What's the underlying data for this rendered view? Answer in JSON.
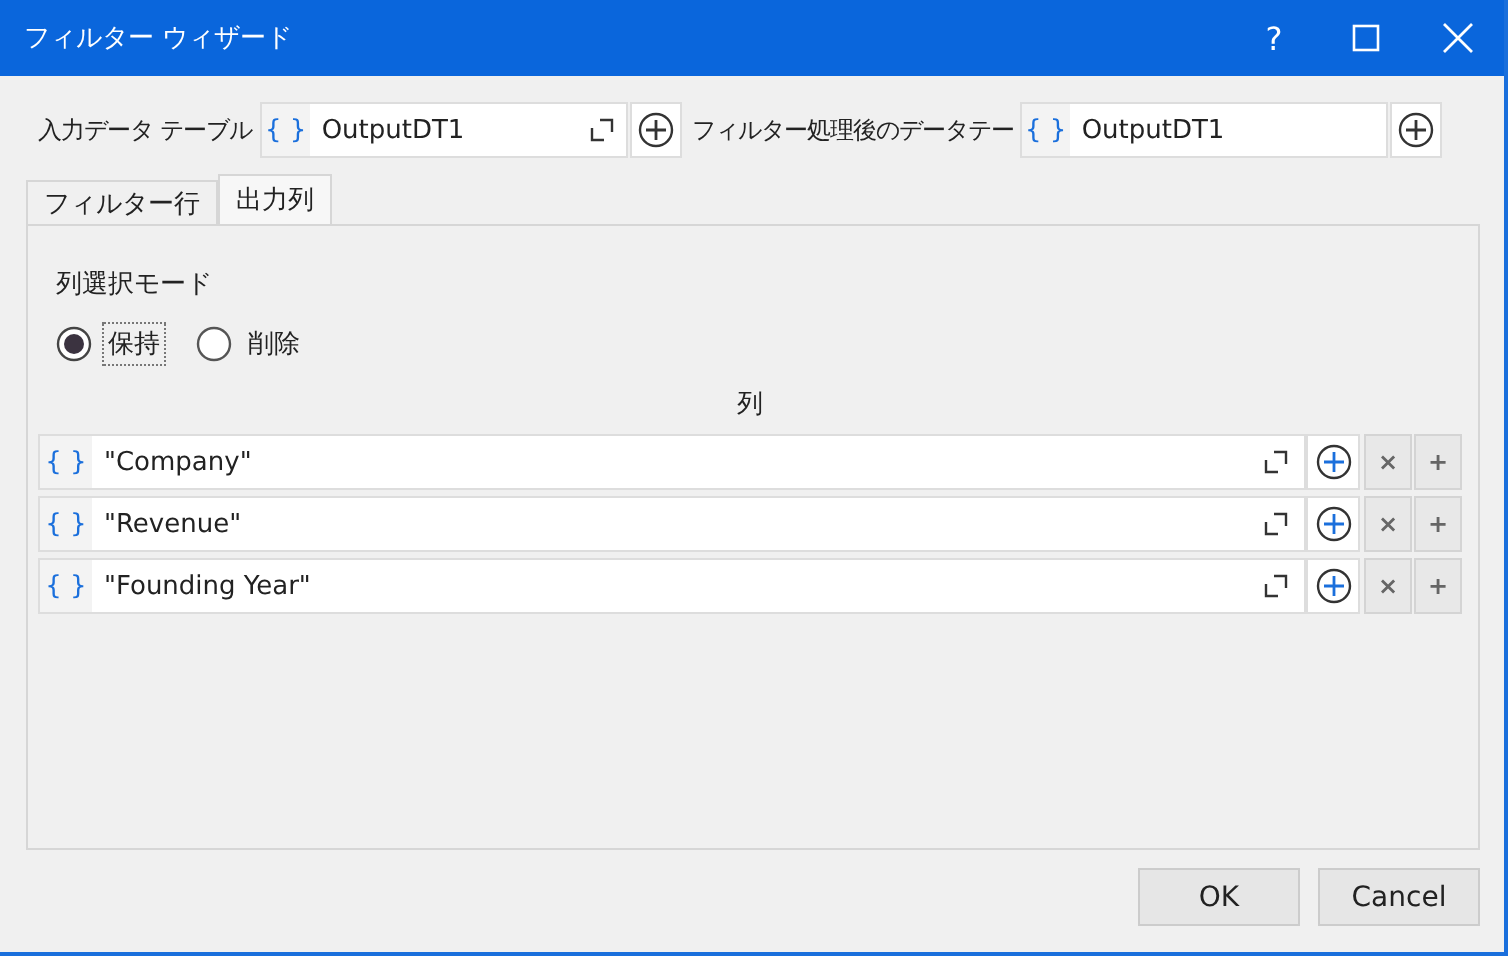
{
  "window": {
    "title": "フィルター ウィザード",
    "help": "?"
  },
  "input_table": {
    "label": "入力データ テーブル",
    "prefix": "{ }",
    "value": "OutputDT1"
  },
  "output_table": {
    "label": "フィルター処理後のデータテー",
    "prefix": "{ }",
    "value": "OutputDT1"
  },
  "tabs": [
    {
      "label": "フィルター行",
      "selected": false
    },
    {
      "label": "出力列",
      "selected": true
    }
  ],
  "mode": {
    "label": "列選択モード",
    "options": [
      {
        "label": "保持",
        "selected": true
      },
      {
        "label": "削除",
        "selected": false
      }
    ]
  },
  "columns": {
    "header": "列",
    "remove": "×",
    "add": "+",
    "rows": [
      {
        "prefix": "{ }",
        "value": "\"Company\""
      },
      {
        "prefix": "{ }",
        "value": "\"Revenue\""
      },
      {
        "prefix": "{ }",
        "value": "\"Founding Year\""
      }
    ]
  },
  "buttons": [
    "OK",
    "Cancel"
  ]
}
